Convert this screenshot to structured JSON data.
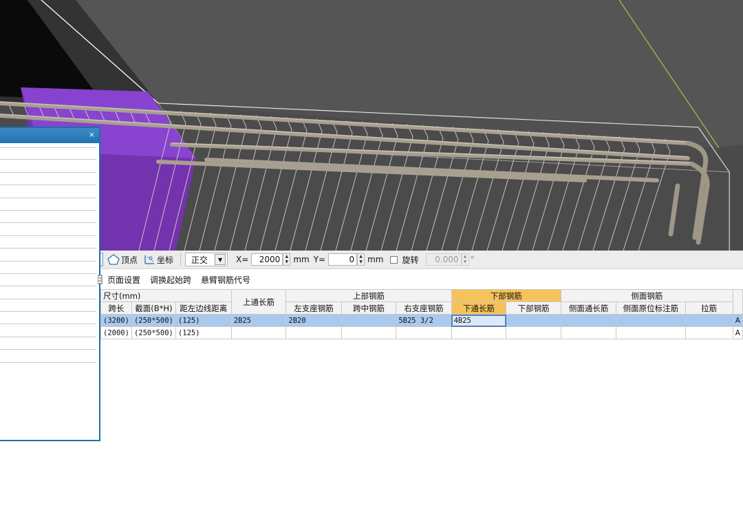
{
  "viewport": {
    "background": "#4a4a4a",
    "accent_purple": "#7a2fc0",
    "guide_line": "#d9cc3b"
  },
  "side_panel": {
    "close_label": "×",
    "row_count": 17
  },
  "snap_toolbar": {
    "vertex_label": "顶点",
    "coord_label": "坐标",
    "mode_value": "正交",
    "x_label": "X=",
    "x_value": "2000",
    "x_unit": "mm",
    "y_label": "Y=",
    "y_value": "0",
    "y_unit": "mm",
    "rotate_label": "旋转",
    "rotate_value": "0.000",
    "degree_symbol": "°"
  },
  "cmd_toolbar": {
    "items": [
      "页面设置",
      "调换起始跨",
      "悬臂钢筋代号"
    ]
  },
  "table": {
    "group_headers": {
      "size": "尺寸(mm)",
      "top_through": "上通长筋",
      "top_rebar": "上部钢筋",
      "bottom_rebar": "下部钢筋",
      "side_rebar": "侧面钢筋"
    },
    "columns": {
      "span_length": "跨长",
      "section": "截面(B*H)",
      "left_edge": "距左边线距离",
      "left_support": "左支座钢筋",
      "mid_span": "跨中钢筋",
      "right_support": "右支座钢筋",
      "bottom_through": "下通长筋",
      "bottom_bars": "下部钢筋",
      "side_through": "侧面通长筋",
      "side_annotation": "侧面原位标注筋",
      "tie_bar": "拉筋"
    },
    "rows": [
      {
        "span_length": "(3200)",
        "section": "(250*500)",
        "left_edge": "(125)",
        "top_through": "2B25",
        "left_support": "2B20",
        "mid_span": "",
        "right_support": "5B25 3/2",
        "bottom_through": "4B25",
        "bottom_bars": "",
        "side_through": "",
        "side_annotation": "",
        "tie_bar": "",
        "cut": "A"
      },
      {
        "span_length": "(2000)",
        "section": "(250*500)",
        "left_edge": "(125)",
        "top_through": "",
        "left_support": "",
        "mid_span": "",
        "right_support": "",
        "bottom_through": "",
        "bottom_bars": "",
        "side_through": "",
        "side_annotation": "",
        "tie_bar": "",
        "cut": "A"
      }
    ]
  }
}
